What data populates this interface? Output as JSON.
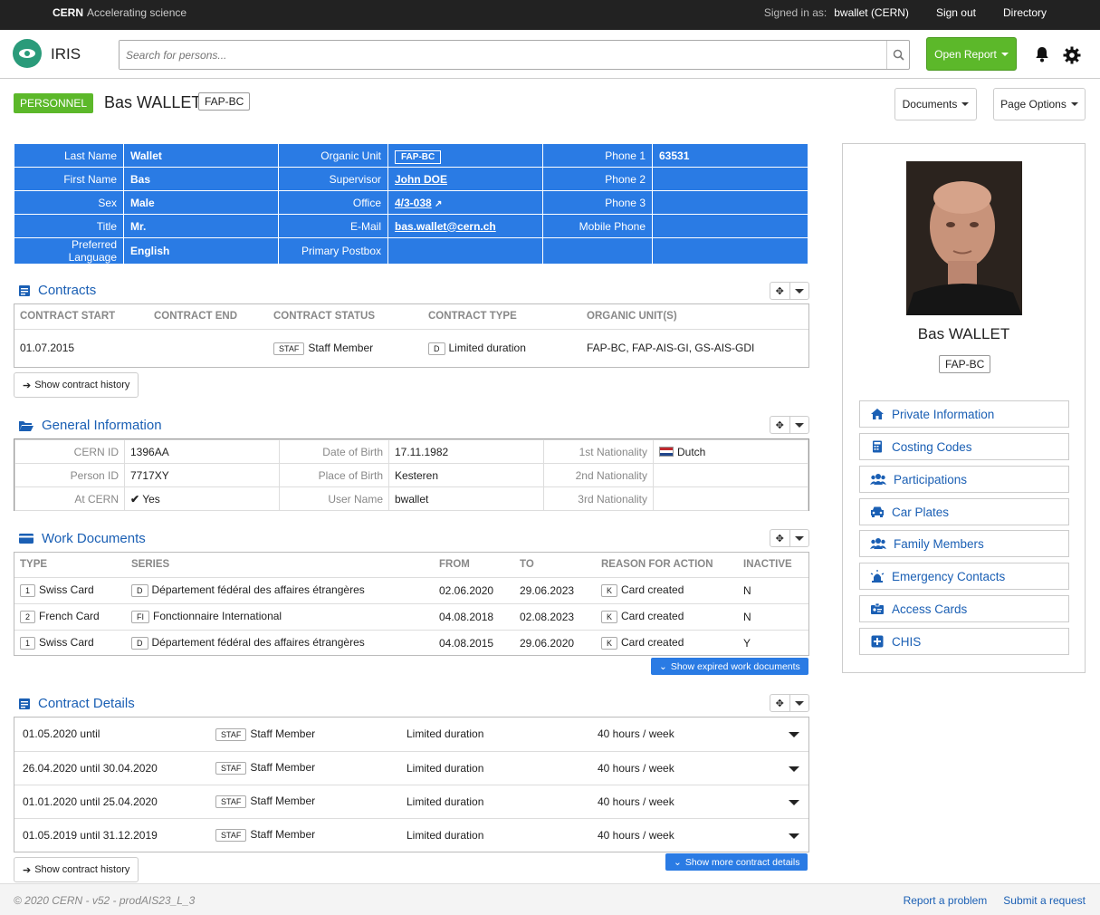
{
  "topbar": {
    "brand_bold": "CERN",
    "brand_text": "Accelerating science",
    "signed_in_label": "Signed in as:",
    "signed_in_user": "bwallet (CERN)",
    "sign_out": "Sign out",
    "directory": "Directory"
  },
  "header": {
    "app_title": "IRIS",
    "search_placeholder": "Search for persons...",
    "open_report": "Open Report"
  },
  "page": {
    "badge": "PERSONNEL",
    "name": "Bas WALLET",
    "unit_tag": "FAP-BC",
    "documents_btn": "Documents",
    "page_options_btn": "Page Options"
  },
  "identity": {
    "last_name_label": "Last Name",
    "last_name": "Wallet",
    "first_name_label": "First Name",
    "first_name": "Bas",
    "sex_label": "Sex",
    "sex": "Male",
    "title_label": "Title",
    "title": "Mr.",
    "pref_lang_label": "Preferred Language",
    "pref_lang": "English",
    "organic_unit_label": "Organic Unit",
    "organic_unit": "FAP-BC",
    "supervisor_label": "Supervisor",
    "supervisor": "John DOE",
    "office_label": "Office",
    "office": "4/3-038",
    "email_label": "E-Mail",
    "email": "bas.wallet@cern.ch",
    "postbox_label": "Primary Postbox",
    "phone1_label": "Phone 1",
    "phone1": "63531",
    "phone2_label": "Phone 2",
    "phone3_label": "Phone 3",
    "mobile_label": "Mobile Phone"
  },
  "contracts": {
    "title": "Contracts",
    "headers": [
      "CONTRACT START",
      "CONTRACT END",
      "CONTRACT STATUS",
      "CONTRACT TYPE",
      "ORGANIC UNIT(S)"
    ],
    "row": {
      "start": "01.07.2015",
      "end": "",
      "status_tag": "STAF",
      "status": "Staff Member",
      "type_tag": "D",
      "type": "Limited duration",
      "units": "FAP-BC, FAP-AIS-GI, GS-AIS-GDI"
    },
    "history_btn": "Show contract history"
  },
  "general": {
    "title": "General Information",
    "cern_id_label": "CERN ID",
    "cern_id": "1396AA",
    "person_id_label": "Person ID",
    "person_id": "7717XY",
    "at_cern_label": "At CERN",
    "at_cern": "Yes",
    "dob_label": "Date of Birth",
    "dob": "17.11.1982",
    "pob_label": "Place of Birth",
    "pob": "Kesteren",
    "username_label": "User Name",
    "username": "bwallet",
    "nat1_label": "1st Nationality",
    "nat1": "Dutch",
    "nat2_label": "2nd Nationality",
    "nat3_label": "3rd Nationality"
  },
  "work_docs": {
    "title": "Work Documents",
    "headers": [
      "TYPE",
      "SERIES",
      "FROM",
      "TO",
      "REASON FOR ACTION",
      "INACTIVE"
    ],
    "rows": [
      {
        "type_tag": "1",
        "type": "Swiss Card",
        "series_tag": "D",
        "series": "Département fédéral des affaires étrangères",
        "from": "02.06.2020",
        "to": "29.06.2023",
        "reason_tag": "K",
        "reason": "Card created",
        "inactive": "N"
      },
      {
        "type_tag": "2",
        "type": "French Card",
        "series_tag": "FI",
        "series": "Fonctionnaire International",
        "from": "04.08.2018",
        "to": "02.08.2023",
        "reason_tag": "K",
        "reason": "Card created",
        "inactive": "N"
      },
      {
        "type_tag": "1",
        "type": "Swiss Card",
        "series_tag": "D",
        "series": "Département fédéral des affaires étrangères",
        "from": "04.08.2015",
        "to": "29.06.2020",
        "reason_tag": "K",
        "reason": "Card created",
        "inactive": "Y"
      }
    ],
    "expired_btn": "Show expired work documents"
  },
  "contract_details": {
    "title": "Contract Details",
    "rows": [
      {
        "period": "01.05.2020 until",
        "tag": "STAF",
        "status": "Staff Member",
        "duration": "Limited duration",
        "hours": "40 hours / week"
      },
      {
        "period": "26.04.2020 until 30.04.2020",
        "tag": "STAF",
        "status": "Staff Member",
        "duration": "Limited duration",
        "hours": "40 hours / week"
      },
      {
        "period": "01.01.2020 until 25.04.2020",
        "tag": "STAF",
        "status": "Staff Member",
        "duration": "Limited duration",
        "hours": "40 hours / week"
      },
      {
        "period": "01.05.2019 until 31.12.2019",
        "tag": "STAF",
        "status": "Staff Member",
        "duration": "Limited duration",
        "hours": "40 hours / week"
      }
    ],
    "history_btn": "Show contract history",
    "more_btn": "Show more contract details"
  },
  "sidebar": {
    "name": "Bas WALLET",
    "tag": "FAP-BC",
    "items": [
      {
        "label": "Private Information",
        "icon": "home-icon"
      },
      {
        "label": "Costing Codes",
        "icon": "calculator-icon"
      },
      {
        "label": "Participations",
        "icon": "users-icon"
      },
      {
        "label": "Car Plates",
        "icon": "car-icon"
      },
      {
        "label": "Family Members",
        "icon": "users-icon"
      },
      {
        "label": "Emergency Contacts",
        "icon": "alarm-icon"
      },
      {
        "label": "Access Cards",
        "icon": "id-card-icon"
      },
      {
        "label": "CHIS",
        "icon": "plus-square-icon"
      }
    ]
  },
  "footer": {
    "copyright": "© 2020 CERN - v52 - prodAIS23_L_3",
    "report": "Report a problem",
    "submit": "Submit a request"
  },
  "colors": {
    "accent_blue": "#2a7be4",
    "brand_green": "#5cb82a",
    "link": "#1a5fb4"
  }
}
